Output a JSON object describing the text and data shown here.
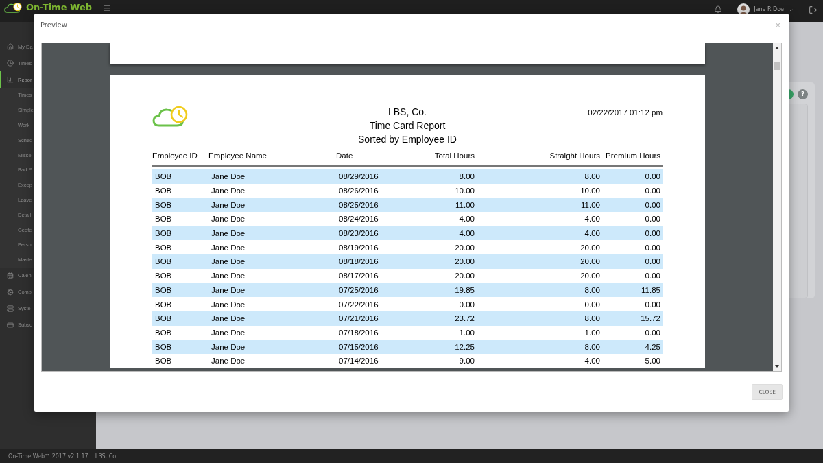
{
  "topbar": {
    "logo": "On-Time Web",
    "user": "Jane R Doe"
  },
  "sidebar": {
    "items": [
      {
        "label": "My Da",
        "selected": false
      },
      {
        "label": "Times",
        "selected": false
      },
      {
        "label": "Repor",
        "selected": true,
        "children": [
          {
            "label": "Times"
          },
          {
            "label": "Simple"
          },
          {
            "label": "Work"
          },
          {
            "label": "Sched"
          },
          {
            "label": "Misse"
          },
          {
            "label": "Bad P"
          },
          {
            "label": "Excep"
          },
          {
            "label": "Leave"
          },
          {
            "label": "Detail"
          },
          {
            "label": "Geofe"
          },
          {
            "label": "Perso"
          },
          {
            "label": "Maste"
          }
        ]
      },
      {
        "label": "Calen",
        "selected": false
      },
      {
        "label": "Comp",
        "selected": false
      },
      {
        "label": "Syste",
        "selected": false
      },
      {
        "label": "Subsc",
        "selected": false
      }
    ]
  },
  "panel": {
    "help": "?"
  },
  "modal": {
    "title": "Preview",
    "close": "×",
    "button": "CLOSE",
    "report": {
      "company": "LBS, Co.",
      "title": "Time Card Report",
      "subtitle": "Sorted by Employee ID",
      "timestamp": "02/22/2017 01:12 pm",
      "columns": [
        "Employee ID",
        "Employee Name",
        "Date",
        "Total Hours",
        "Straight Hours",
        "Premium Hours"
      ],
      "rows": [
        [
          "BOB",
          "Jane Doe",
          "08/29/2016",
          "8.00",
          "8.00",
          "0.00"
        ],
        [
          "BOB",
          "Jane Doe",
          "08/26/2016",
          "10.00",
          "10.00",
          "0.00"
        ],
        [
          "BOB",
          "Jane Doe",
          "08/25/2016",
          "11.00",
          "11.00",
          "0.00"
        ],
        [
          "BOB",
          "Jane Doe",
          "08/24/2016",
          "4.00",
          "4.00",
          "0.00"
        ],
        [
          "BOB",
          "Jane Doe",
          "08/23/2016",
          "4.00",
          "4.00",
          "0.00"
        ],
        [
          "BOB",
          "Jane Doe",
          "08/19/2016",
          "20.00",
          "20.00",
          "0.00"
        ],
        [
          "BOB",
          "Jane Doe",
          "08/18/2016",
          "20.00",
          "20.00",
          "0.00"
        ],
        [
          "BOB",
          "Jane Doe",
          "08/17/2016",
          "20.00",
          "20.00",
          "0.00"
        ],
        [
          "BOB",
          "Jane Doe",
          "07/25/2016",
          "19.85",
          "8.00",
          "11.85"
        ],
        [
          "BOB",
          "Jane Doe",
          "07/22/2016",
          "0.00",
          "0.00",
          "0.00"
        ],
        [
          "BOB",
          "Jane Doe",
          "07/21/2016",
          "23.72",
          "8.00",
          "15.72"
        ],
        [
          "BOB",
          "Jane Doe",
          "07/18/2016",
          "1.00",
          "1.00",
          "0.00"
        ],
        [
          "BOB",
          "Jane Doe",
          "07/15/2016",
          "12.25",
          "8.00",
          "4.25"
        ],
        [
          "BOB",
          "Jane Doe",
          "07/14/2016",
          "9.00",
          "4.00",
          "5.00"
        ]
      ]
    }
  },
  "status_bar": {
    "product": "On-Time Web™ 2017 v2.1.17",
    "company": "LBS, Co."
  }
}
